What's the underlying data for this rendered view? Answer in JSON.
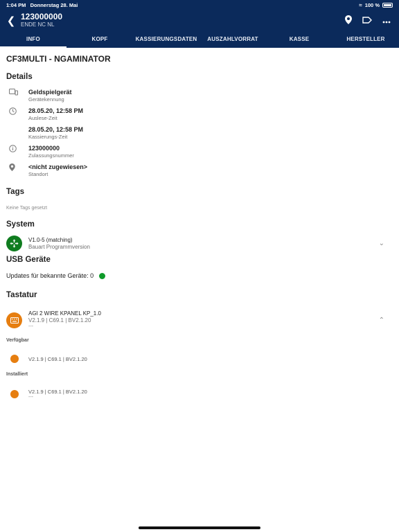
{
  "status": {
    "time": "1:04 PM",
    "date": "Donnerstag 28. Mai",
    "battery": "100 %"
  },
  "header": {
    "title": "123000000",
    "subtitle": "ENDE NC NL"
  },
  "tabs": [
    "INFO",
    "KOPF",
    "KASSIERUNGSDATEN",
    "AUSZAHLVORRAT",
    "KASSE",
    "HERSTELLER"
  ],
  "machine_title": "CF3MULTI - NGAMINATOR",
  "details": {
    "heading": "Details",
    "items": [
      {
        "value": "Geldspielgerät",
        "label": "Gerätekennung",
        "icon": "device-icon"
      },
      {
        "value": "28.05.20, 12:58 PM",
        "label": "Auslese-Zeit",
        "icon": "clock-icon"
      },
      {
        "value": "28.05.20, 12:58 PM",
        "label": "Kassierungs-Zeit",
        "icon": ""
      },
      {
        "value": "123000000",
        "label": "Zulassungsnummer",
        "icon": "info-icon"
      },
      {
        "value": "<nicht zugewiesen>",
        "label": "Standort",
        "icon": "location-pin-icon"
      }
    ]
  },
  "tags": {
    "heading": "Tags",
    "empty": "Keine Tags gesetzt"
  },
  "system": {
    "heading": "System",
    "line1": "V1.0-5 (matching)",
    "line2": "Bauart Programmversion"
  },
  "usb": {
    "heading": "USB Geräte",
    "text": "Updates für bekannte Geräte: 0"
  },
  "keyboard": {
    "heading": "Tastatur",
    "name": "AGI 2 WIRE KPANEL KP_1.0",
    "version": "V2.1.9 | C69.1 | BV2.1.20",
    "extra": "---",
    "available_label": "Verfügbar",
    "available_version": "V2.1.9 | C69.1 | BV2.1.20",
    "installed_label": "Installiert",
    "installed_version": "V2.1.9 | C69.1 | BV2.1.20",
    "installed_extra": "---"
  },
  "colors": {
    "header_bg": "#0b2a5b",
    "green": "#0f7c1f",
    "orange": "#e67e10",
    "status_dot": "#0f9b2a"
  }
}
